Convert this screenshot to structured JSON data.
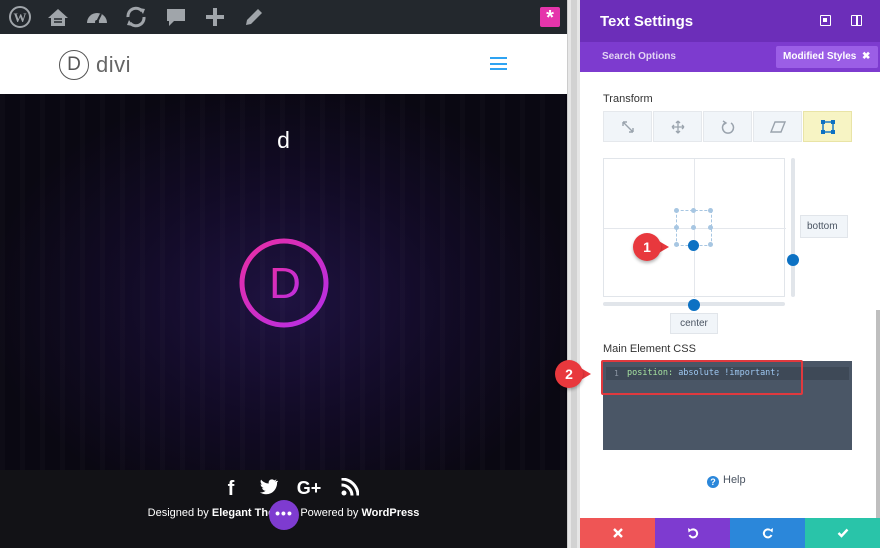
{
  "admin_bar": {
    "icons": [
      "wordpress-icon",
      "site-icon",
      "dashboard-icon",
      "updates-icon",
      "comments-icon",
      "new-content-icon",
      "edit-icon",
      "divi-icon"
    ]
  },
  "site": {
    "logo_letter": "D",
    "logo_text": "divi",
    "hero_text": "d",
    "hero_logo_letter": "D",
    "social_icons": {
      "facebook": "f",
      "google_plus": "G+"
    },
    "credits": {
      "prefix": "Designed by",
      "theme_name": "Elegant The",
      "middle": "Powered by",
      "platform": "WordPress"
    },
    "dots_label": "•••"
  },
  "panel": {
    "title": "Text Settings",
    "search_options": "Search Options",
    "modified_styles": "Modified Styles",
    "modified_close": "✖",
    "transform_label": "Transform",
    "transform_tools": [
      "scale",
      "translate",
      "rotate",
      "skew",
      "origin"
    ],
    "active_tool": "origin",
    "origin_x_label": "center",
    "origin_y_label": "bottom",
    "css_label": "Main Element CSS",
    "css_line_number": "1",
    "css_property": "position:",
    "css_value": "absolute !important;",
    "help_label": "Help",
    "help_icon": "?",
    "footer_buttons": [
      "discard",
      "undo",
      "redo",
      "save"
    ]
  },
  "annotations": {
    "callout_1": "1",
    "callout_2": "2"
  },
  "colors": {
    "panel_purple": "#6c2eb9",
    "accent_blue": "#0c71c3",
    "discard_red": "#ef5555",
    "save_green": "#29c4a9",
    "callout_red": "#e8383d"
  }
}
